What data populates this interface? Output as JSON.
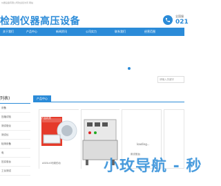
{
  "topbar": {
    "text": "仪器设备有限公司欢迎您访问 网站"
  },
  "header": {
    "logo_text": "检测仪器高压设备",
    "phone_label": "全国服",
    "phone_number": "021"
  },
  "nav": {
    "items": [
      "关于我们",
      "产品中心",
      "新闻资讯",
      "公司实力",
      "联系我们",
      "经营范围"
    ]
  },
  "search": {
    "placeholder": "请输入关键字"
  },
  "sidebar": {
    "title": "列表)",
    "items": [
      "设备",
      "压缩试验",
      "测试验仪",
      "测试仪",
      "检测设备",
      "电",
      "压实验台",
      "工仪测试"
    ]
  },
  "main": {
    "tab_label": "产品中心",
    "loading_text": "loading...",
    "captions": [
      "ASEX-K可调式动",
      "",
      "用试验台"
    ],
    "product_badge": "产品材质"
  },
  "watermark": {
    "text": "小玫导航 - 秒"
  },
  "colors": {
    "brand": "#2b8bd8"
  }
}
